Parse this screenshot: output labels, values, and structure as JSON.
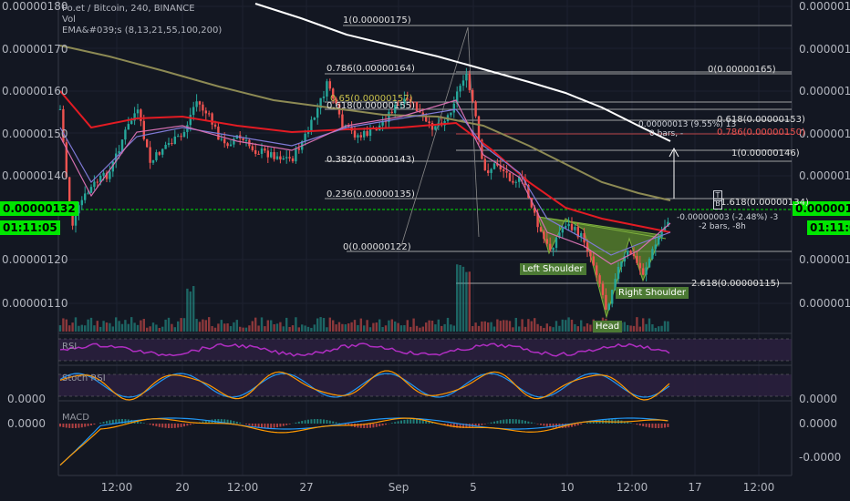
{
  "header": {
    "symbol": "Po.et / Bitcoin, 240, BINANCE",
    "vol": "Vol",
    "ema": "EMA&#039;s (8,13,21,55,100,200)"
  },
  "price_axis_left": [
    "0.00000180",
    "0.00000170",
    "0.00000160",
    "0.00000150",
    "0.00000140",
    "0.00000120",
    "0.00000110"
  ],
  "price_axis_right": [
    "0.00000180",
    "0.00000170",
    "0.00000160",
    "0.00000150",
    "0.00000140",
    "0.00000120",
    "0.00000110"
  ],
  "current_price": "0.00000132",
  "countdown": "01:11:05",
  "panes": {
    "rsi": "RSI",
    "stoch": "Stoch RSI",
    "macd": "MACD",
    "stoch_axis": "0.0000",
    "macd_axis_top": "0.0000",
    "macd_axis_bottom": "-0.0000"
  },
  "right_axis_extra": [
    "0.0000",
    "0.0000",
    "0.0000"
  ],
  "x_axis": [
    "12:00",
    "20",
    "12:00",
    "27",
    "Sep",
    "5",
    "10",
    "12:00",
    "17",
    "12:00"
  ],
  "fib_left": [
    {
      "text": "1(0.00000175)"
    },
    {
      "text": "0.786(0.00000164)"
    },
    {
      "text": "0.65(0.00000157)"
    },
    {
      "text": "0.618(0.00000155)"
    },
    {
      "text": "0.382(0.00000143)"
    },
    {
      "text": "0.236(0.00000135)"
    },
    {
      "text": "0(0.00000122)"
    }
  ],
  "fib_right": [
    {
      "text": "0(0.00000165)"
    },
    {
      "text": "0.618(0.00000153)"
    },
    {
      "text": "0.786(0.00000150)"
    },
    {
      "text": "1(0.00000146)"
    },
    {
      "text": "1.618(0.00000134)"
    },
    {
      "text": "2.618(0.00000115)"
    }
  ],
  "notes": {
    "measure_up": "0.00000013 (9.55%) 13",
    "measure_up_bars": "0 bars, -",
    "measure_down": "-0.00000003 (-2.48%) -3",
    "measure_down_bars": "-2 bars, -8h",
    "flag_top": "T",
    "flag_bottom": "B"
  },
  "patterns": {
    "left_shoulder": "Left Shoulder",
    "head": "Head",
    "right_shoulder": "Right Shoulder"
  },
  "colors": {
    "up": "#26a69a",
    "down": "#ef5350",
    "ema200": "#ffffff",
    "ema100": "#8d8a54",
    "ema55": "#e31b23",
    "rsi": "#b02ec2",
    "pattern": "#5e8b2e",
    "price_tag": "#00e600"
  }
}
